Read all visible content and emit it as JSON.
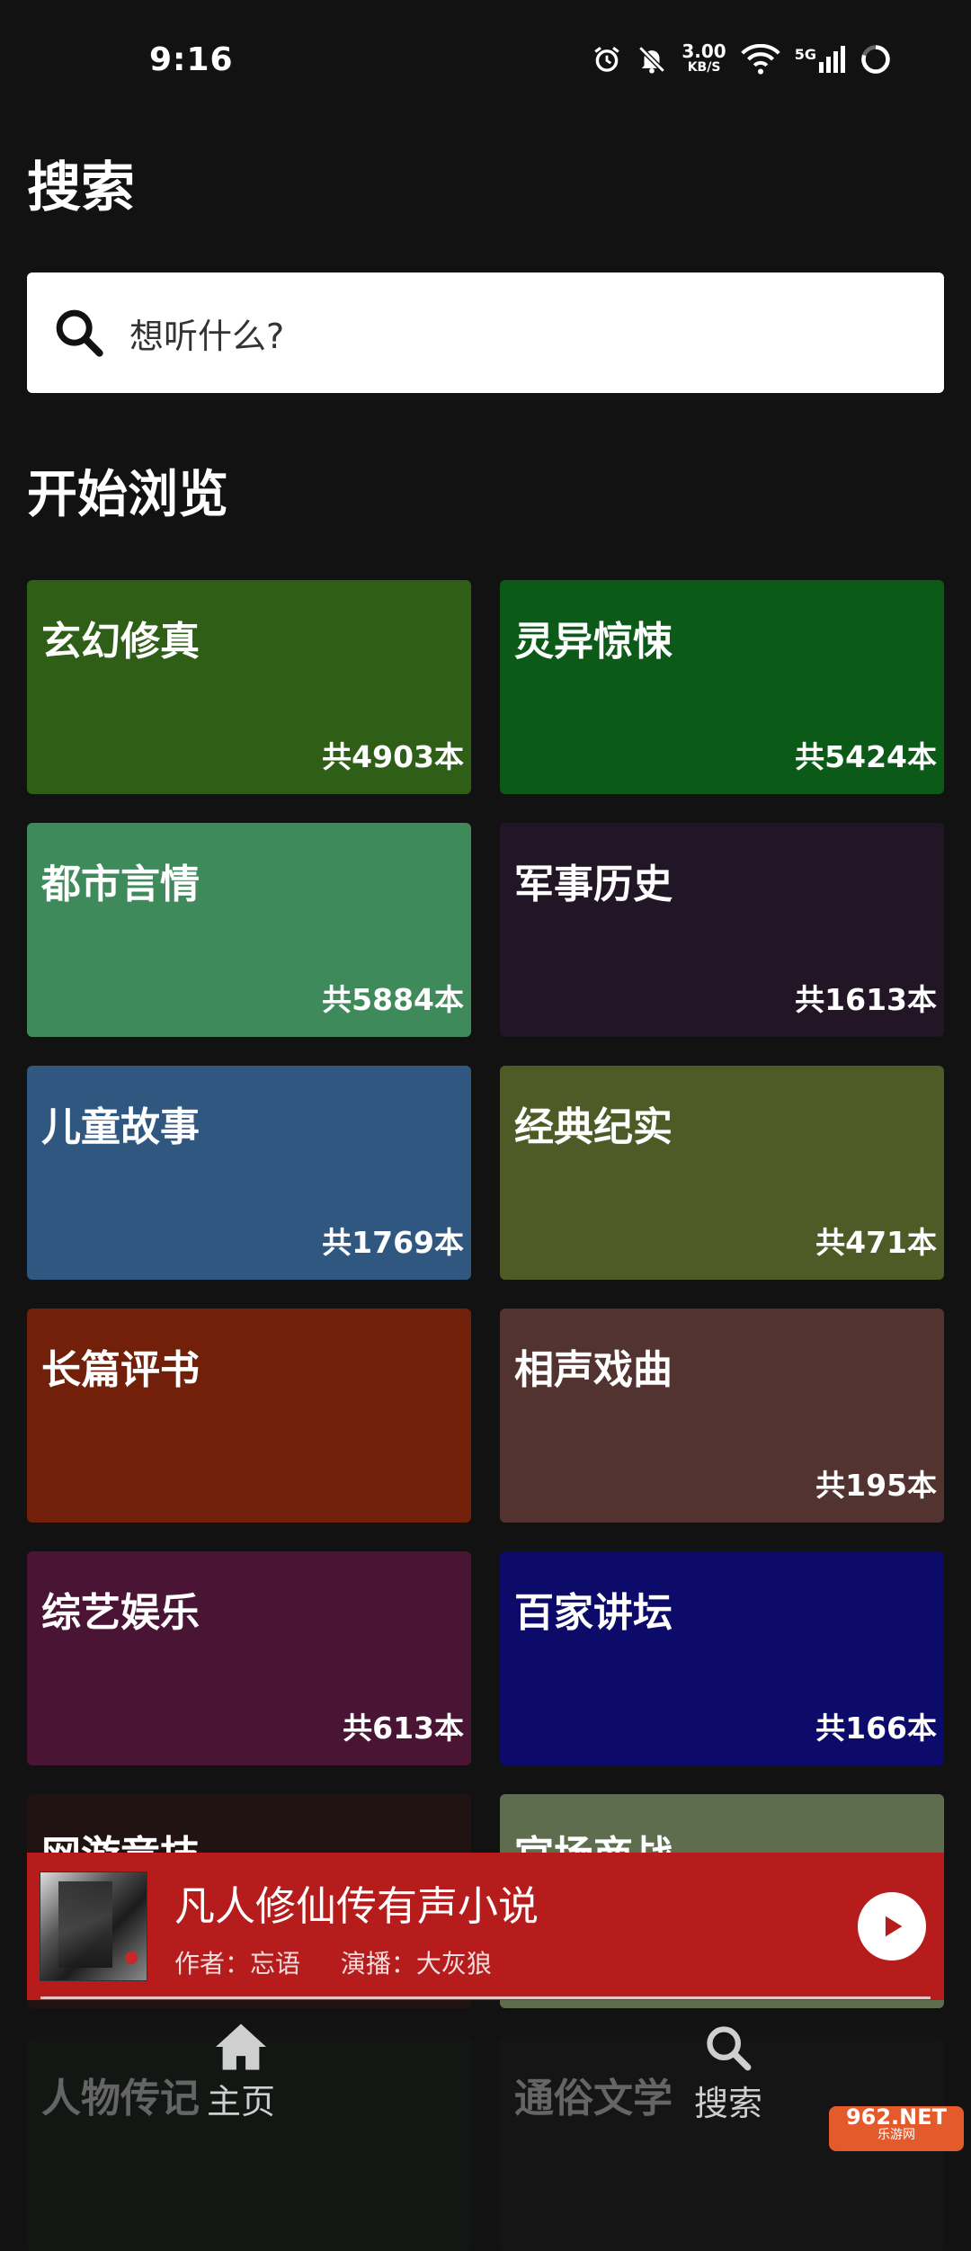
{
  "status_bar": {
    "time": "9:16",
    "speed_value": "3.00",
    "speed_unit": "KB/S",
    "network": "5G"
  },
  "page_title": "搜索",
  "search": {
    "placeholder": "想听什么?"
  },
  "section_title": "开始浏览",
  "categories": [
    {
      "name": "玄幻修真",
      "count": "共4903本",
      "color": "#2f5f17"
    },
    {
      "name": "灵异惊悚",
      "count": "共5424本",
      "color": "#0b5a18"
    },
    {
      "name": "都市言情",
      "count": "共5884本",
      "color": "#3f8a5b"
    },
    {
      "name": "军事历史",
      "count": "共1613本",
      "color": "#221526"
    },
    {
      "name": "儿童故事",
      "count": "共1769本",
      "color": "#30577f"
    },
    {
      "name": "经典纪实",
      "count": "共471本",
      "color": "#4f5b26"
    },
    {
      "name": "长篇评书",
      "count": "",
      "color": "#72200a"
    },
    {
      "name": "相声戏曲",
      "count": "共195本",
      "color": "#53332f"
    },
    {
      "name": "综艺娱乐",
      "count": "共613本",
      "color": "#4a1434"
    },
    {
      "name": "百家讲坛",
      "count": "共166本",
      "color": "#0d0b6a"
    },
    {
      "name": "网游竞技",
      "count": "",
      "color": "#221313"
    },
    {
      "name": "官场商战",
      "count": "",
      "color": "#5f6d4f"
    },
    {
      "name": "人物传记",
      "count": "",
      "color": "#15231a"
    },
    {
      "name": "通俗文学",
      "count": "",
      "color": "#1d1d1d"
    }
  ],
  "player": {
    "title": "凡人修仙传有声小说",
    "author": "作者：忘语",
    "narrator": "演播：大灰狼",
    "progress": 0.0
  },
  "bottom_nav": {
    "home": "主页",
    "search": "搜索"
  },
  "watermark": {
    "brand": "962.NET",
    "sub": "乐游网"
  }
}
